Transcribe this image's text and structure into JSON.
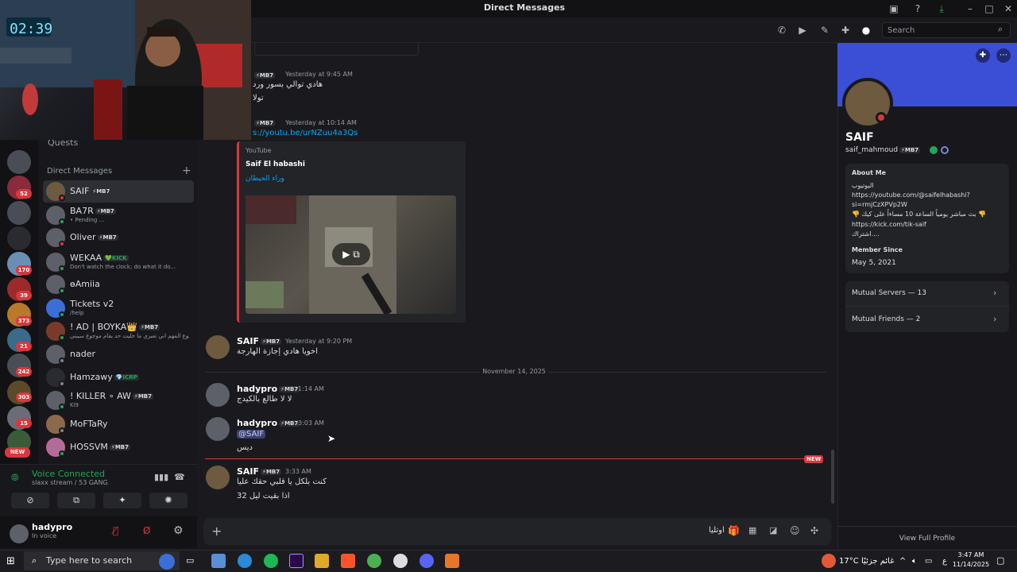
{
  "window": {
    "title": "Direct Messages"
  },
  "rail": {
    "badges": [
      "52",
      "170",
      "39",
      "373",
      "21",
      "242",
      "303",
      "15"
    ],
    "new_label": "NEW"
  },
  "sidebar": {
    "quests": "Quests",
    "dm_header": "Direct Messages",
    "dms": [
      {
        "name": "SAIF",
        "tag": "⚡MB7",
        "sub": ""
      },
      {
        "name": "BA7R",
        "tag": "⚡MB7",
        "sub": "• Pending ..."
      },
      {
        "name": "Oliver",
        "tag": "⚡MB7",
        "sub": ""
      },
      {
        "name": "WEKAA",
        "tag": "💚KICK",
        "sub": "Don't watch the clock; do what it do..."
      },
      {
        "name": "ɵAmiia",
        "tag": "",
        "sub": ""
      },
      {
        "name": "Tickets v2",
        "tag": "",
        "sub": "/help"
      },
      {
        "name": "! AD | BOYKA👑",
        "tag": "⚡MB7",
        "sub": "موجوع المهم اني تعبري ما خليت حد يقام موجوع سيبني..."
      },
      {
        "name": "nader",
        "tag": "",
        "sub": ""
      },
      {
        "name": "Hamzawy",
        "tag": "💎ICRP",
        "sub": ""
      },
      {
        "name": "! KILLER ∘ AW",
        "tag": "⚡MB7",
        "sub": "Ki9"
      },
      {
        "name": "MoFTaRy",
        "tag": "",
        "sub": ""
      },
      {
        "name": "HOSSVM",
        "tag": "⚡MB7",
        "sub": ""
      }
    ]
  },
  "voice": {
    "title": "Voice Connected",
    "sub": "slaxx stream / 53 GANG"
  },
  "user": {
    "name": "hadypro",
    "status": "In voice"
  },
  "header": {
    "search_placeholder": "Search"
  },
  "messages": {
    "m1": {
      "tag": "⚡MB7",
      "time": "Yesterday at 9:45 AM",
      "line1": "هادي توالي بسور ورد",
      "line2": "تولا"
    },
    "m2": {
      "tag": "⚡MB7",
      "time": "Yesterday at 10:14 AM",
      "link": "s://youtu.be/urNZuu4a3Qs"
    },
    "embed": {
      "provider": "YouTube",
      "title": "Saif El habashi",
      "channel": "وراء الحيطان"
    },
    "m3": {
      "name": "SAIF",
      "tag": "⚡MB7",
      "time": "Yesterday at 9:20 PM",
      "text": "اخويا هادي إجازة الهارجة"
    },
    "date_divider": "November 14, 2025",
    "m4": {
      "name": "hadypro",
      "tag": "⚡MB7",
      "time": "1:14 AM",
      "text": "لا لا طالع بالكيدج"
    },
    "m5": {
      "name": "hadypro",
      "tag": "⚡MB7",
      "time": "3:03 AM",
      "mention": "@SAIF",
      "text": "ديس"
    },
    "new_label": "NEW",
    "m6": {
      "name": "SAIF",
      "tag": "⚡MB7",
      "time": "3:33 AM",
      "line1": "كنت بلكل يا قلبي حقك عليا",
      "line2": "اذا بقيت ليل 32"
    }
  },
  "composer": {
    "arabic_label": "اوتليا"
  },
  "profile": {
    "display_name": "SAIF",
    "username": "saif_mahmoud",
    "tag": "⚡MB7",
    "about_label": "About Me",
    "about_lines": [
      "اليوتيوب",
      "https://youtube.com/@saifelhabashi?",
      "si=rmjCzXPVp2W",
      "👎 بث مباشر يومياً الساعة 10 مساءاً على كيك 👎",
      "https://kick.com/tik-saif",
      "اشتراك...."
    ],
    "member_since_label": "Member Since",
    "member_since": "May 5, 2021",
    "mutual_servers": "Mutual Servers — 13",
    "mutual_friends": "Mutual Friends — 2",
    "view_full": "View Full Profile"
  },
  "taskbar": {
    "search": "Type here to search",
    "weather": "17°C",
    "weather_text": "غائم جزئيًا",
    "lang": "ع",
    "time": "3:47 AM",
    "date": "11/14/2025"
  }
}
